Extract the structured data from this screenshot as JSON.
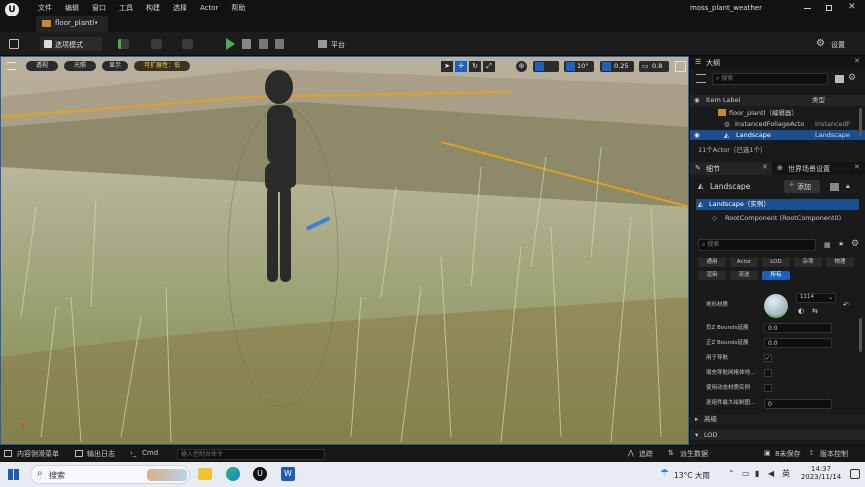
{
  "app": {
    "file_tab": "floor_plantl•",
    "project": "moss_plant_weather"
  },
  "menu": [
    "文件",
    "编辑",
    "窗口",
    "工具",
    "构建",
    "选择",
    "Actor",
    "帮助"
  ],
  "toolbar": {
    "mode": "选项模式",
    "platform": "平台",
    "settings": "设置"
  },
  "viewport": {
    "perspective": "透视",
    "lit": "光照",
    "show": "显示",
    "scalability": "可扩展性：低",
    "snap_angle": "10°",
    "snap_scale": "0.25",
    "camera_speed": "0.8"
  },
  "outliner": {
    "title": "大纲",
    "search_placeholder": "搜索",
    "col_label": "Item Label",
    "col_type": "类型",
    "rows": [
      {
        "label": "floor_plantl（编辑器）",
        "type": ""
      },
      {
        "label": "InstancedFoliageActo",
        "type": "InstancedF"
      },
      {
        "label": "Landscape",
        "type": "Landscape"
      }
    ],
    "count": "11个Actor（已选1个）"
  },
  "details": {
    "tab1": "细节",
    "tab2": "世界场景设置",
    "actor": "Landscape",
    "add": "添加",
    "component_root": "Landscape（实例）",
    "component_child": "RootComponent (RootComponent0)",
    "search_placeholder": "搜索",
    "categories": [
      "通用",
      "Actor",
      "LOD",
      "杂项",
      "物理",
      "渲染",
      "流送",
      "所有"
    ],
    "props": {
      "material_label": "地形材质",
      "material_value": "1114",
      "neg_bounds_label": "负Z Bounds延展",
      "neg_bounds_value": "0.0",
      "pos_bounds_label": "正Z Bounds延展",
      "pos_bounds_value": "0.0",
      "nav_label": "用于导航",
      "nav2_label": "填充导航网格体地...",
      "dyn_label": "使用动态材质实例",
      "max_label": "逐组件最大绘制图...",
      "max_value": "0",
      "sec1": "高级",
      "sec2": "LOD"
    }
  },
  "bottom": {
    "content_drawer": "内容侧滑菜单",
    "output_log": "输出日志",
    "cmd": "Cmd",
    "cmd_placeholder": "输入控制台命令",
    "trace": "追踪",
    "derived": "派生数据",
    "unsaved": "8未保存",
    "source_control": "版本控制"
  },
  "taskbar": {
    "search": "搜索",
    "weather": "13°C 大雨",
    "ime": "英",
    "time": "14:37",
    "date": "2023/11/14"
  }
}
